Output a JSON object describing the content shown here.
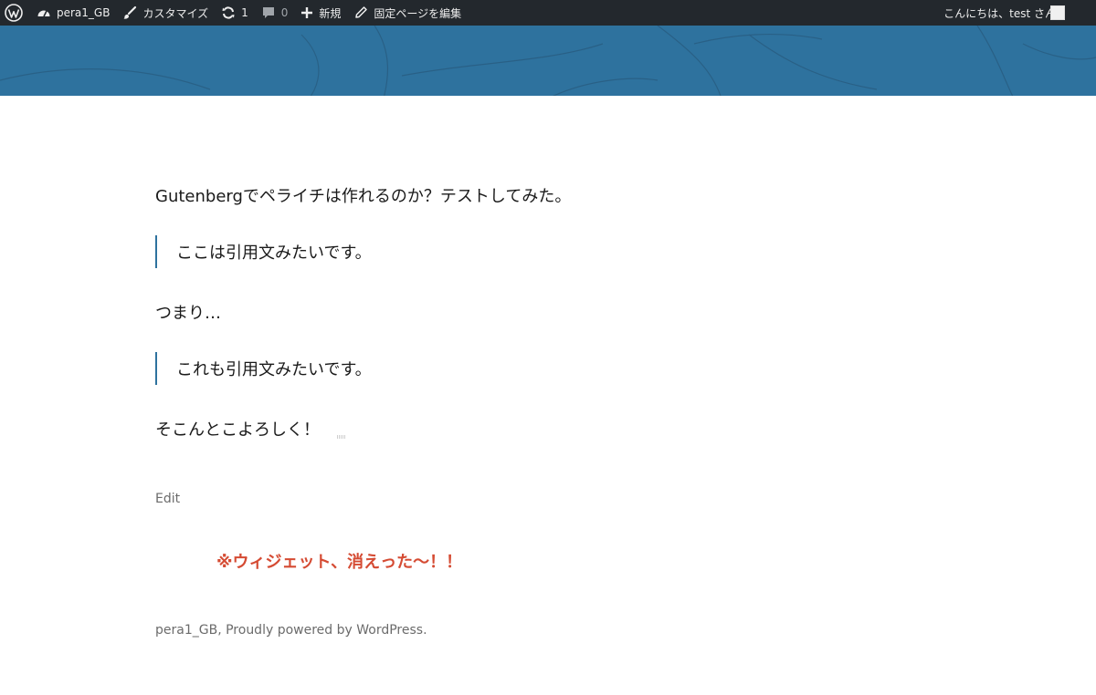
{
  "admin_bar": {
    "site_name": "pera1_GB",
    "customize_label": "カスタマイズ",
    "updates_count": "1",
    "comments_count": "0",
    "new_label": "新規",
    "edit_page_label": "固定ページを編集",
    "greeting": "こんにちは、test さん"
  },
  "post": {
    "paragraph_1": "Gutenbergでペライチは作れるのか？テストしてみた。",
    "quote_1": "ここは引用文みたいです。",
    "paragraph_2": "つまり…",
    "quote_2": "これも引用文みたいです。",
    "paragraph_3": "そこんとこよろしく！",
    "edit_label": "Edit"
  },
  "widget_note": "※ウィジェット、消えった〜！！",
  "footer": {
    "site_link": "pera1_GB",
    "powered_by": ", Proudly powered by WordPress."
  },
  "colors": {
    "admin_bar_bg": "#23282d",
    "header_blue": "#2e729e",
    "quote_border": "#2e729e",
    "note_red": "#d54b33"
  }
}
